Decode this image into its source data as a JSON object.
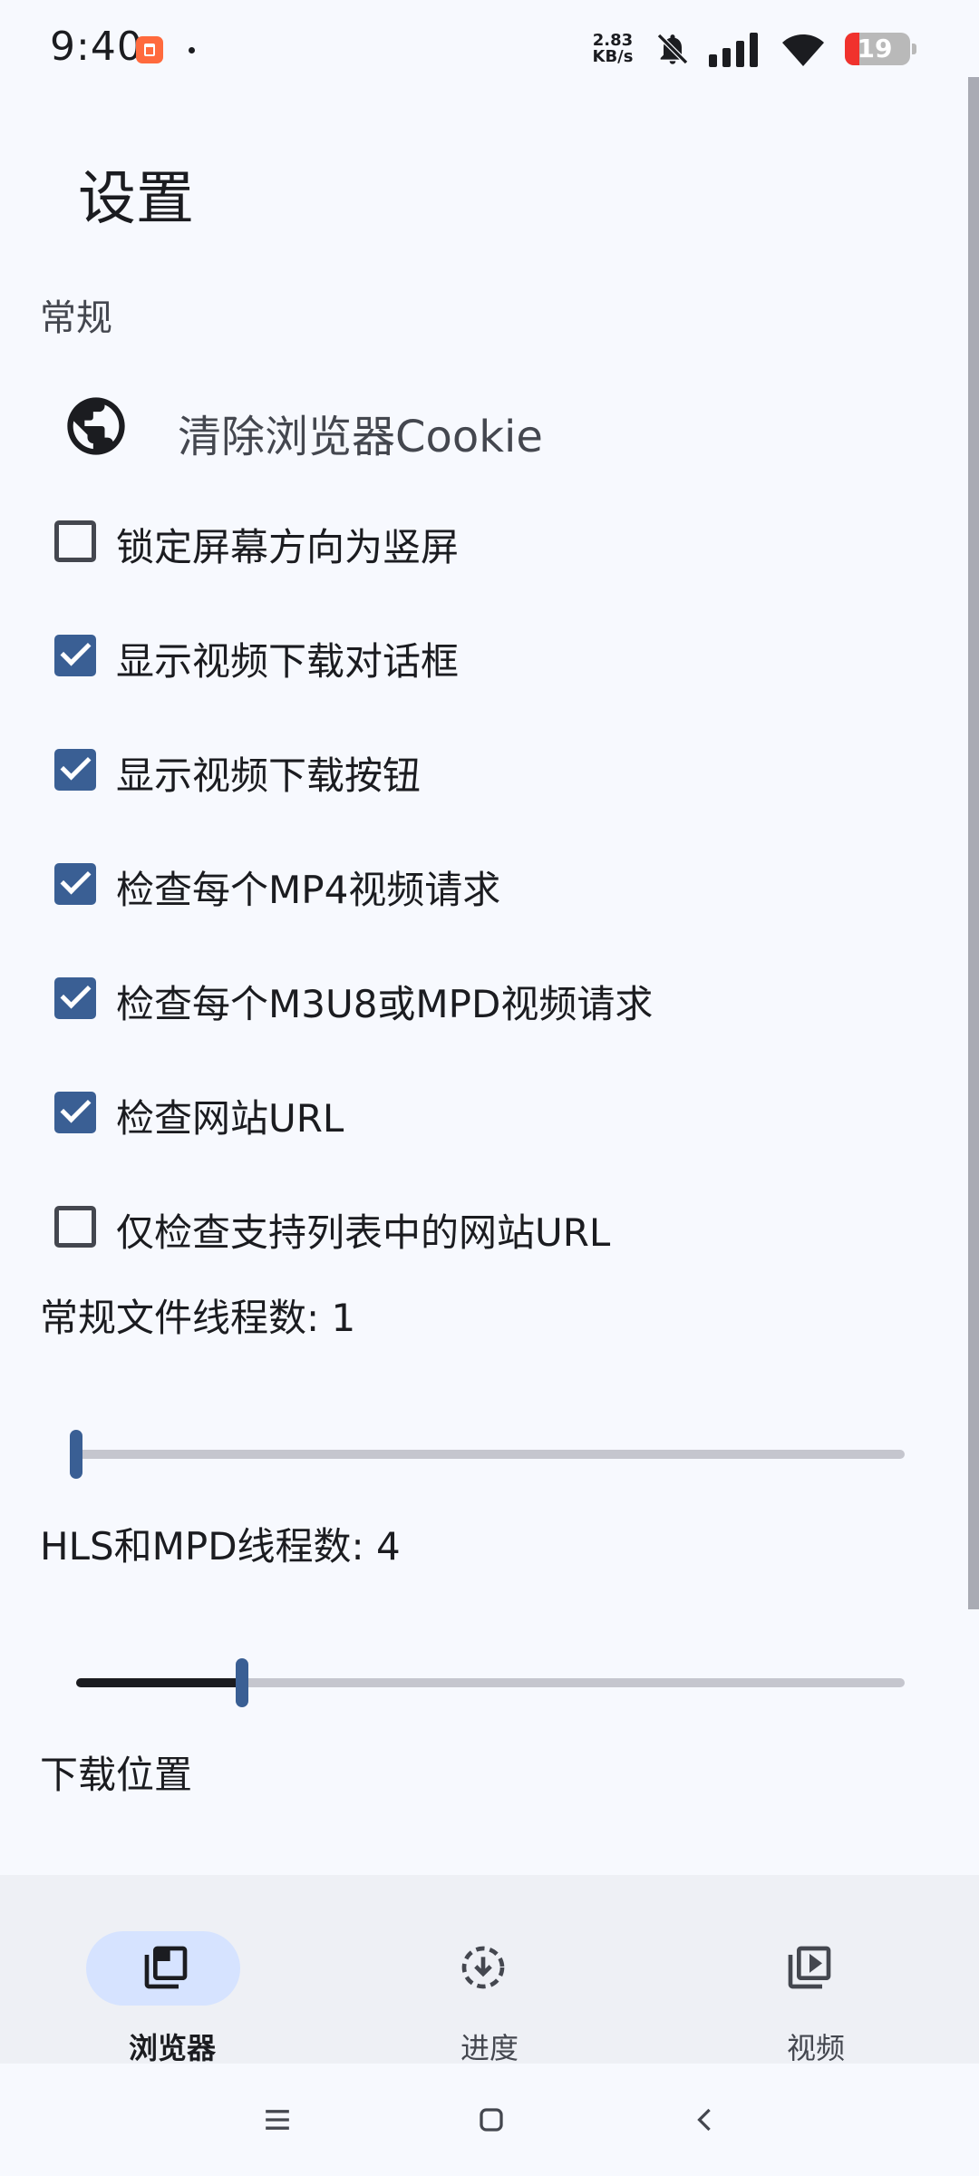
{
  "status_bar": {
    "time": "9:40",
    "net_speed_value": "2.83",
    "net_speed_unit": "KB/s",
    "battery": "19",
    "icons": [
      "app-notification-icon",
      "bell-off-icon",
      "signal-icon",
      "wifi-icon",
      "battery-icon"
    ]
  },
  "page": {
    "title": "设置"
  },
  "general": {
    "section_label": "常规",
    "clear_cookie_label": "清除浏览器Cookie",
    "checkboxes": [
      {
        "label": "锁定屏幕方向为竖屏",
        "checked": false
      },
      {
        "label": "显示视频下载对话框",
        "checked": true
      },
      {
        "label": "显示视频下载按钮",
        "checked": true
      },
      {
        "label": "检查每个MP4视频请求",
        "checked": true
      },
      {
        "label": "检查每个M3U8或MPD视频请求",
        "checked": true
      },
      {
        "label": "检查网站URL",
        "checked": true
      },
      {
        "label": "仅检查支持列表中的网站URL",
        "checked": false
      }
    ]
  },
  "sliders": {
    "regular_threads": {
      "label": "常规文件线程数: 1",
      "value": 1,
      "min": 1,
      "max": 16
    },
    "hls_threads": {
      "label": "HLS和MPD线程数: 4",
      "value": 4,
      "min": 1,
      "max": 16
    }
  },
  "download_location_label": "下载位置",
  "bottom_nav": {
    "items": [
      {
        "label": "浏览器",
        "icon": "browser-tabs-icon",
        "active": true
      },
      {
        "label": "进度",
        "icon": "download-progress-icon",
        "active": false
      },
      {
        "label": "视频",
        "icon": "video-library-icon",
        "active": false
      }
    ]
  },
  "system_nav": {
    "icons": [
      "menu-icon",
      "home-icon",
      "back-icon"
    ]
  },
  "colors": {
    "accent": "#3a5f94",
    "active_pill": "#d6e3ff",
    "background": "#f7f9fe"
  }
}
